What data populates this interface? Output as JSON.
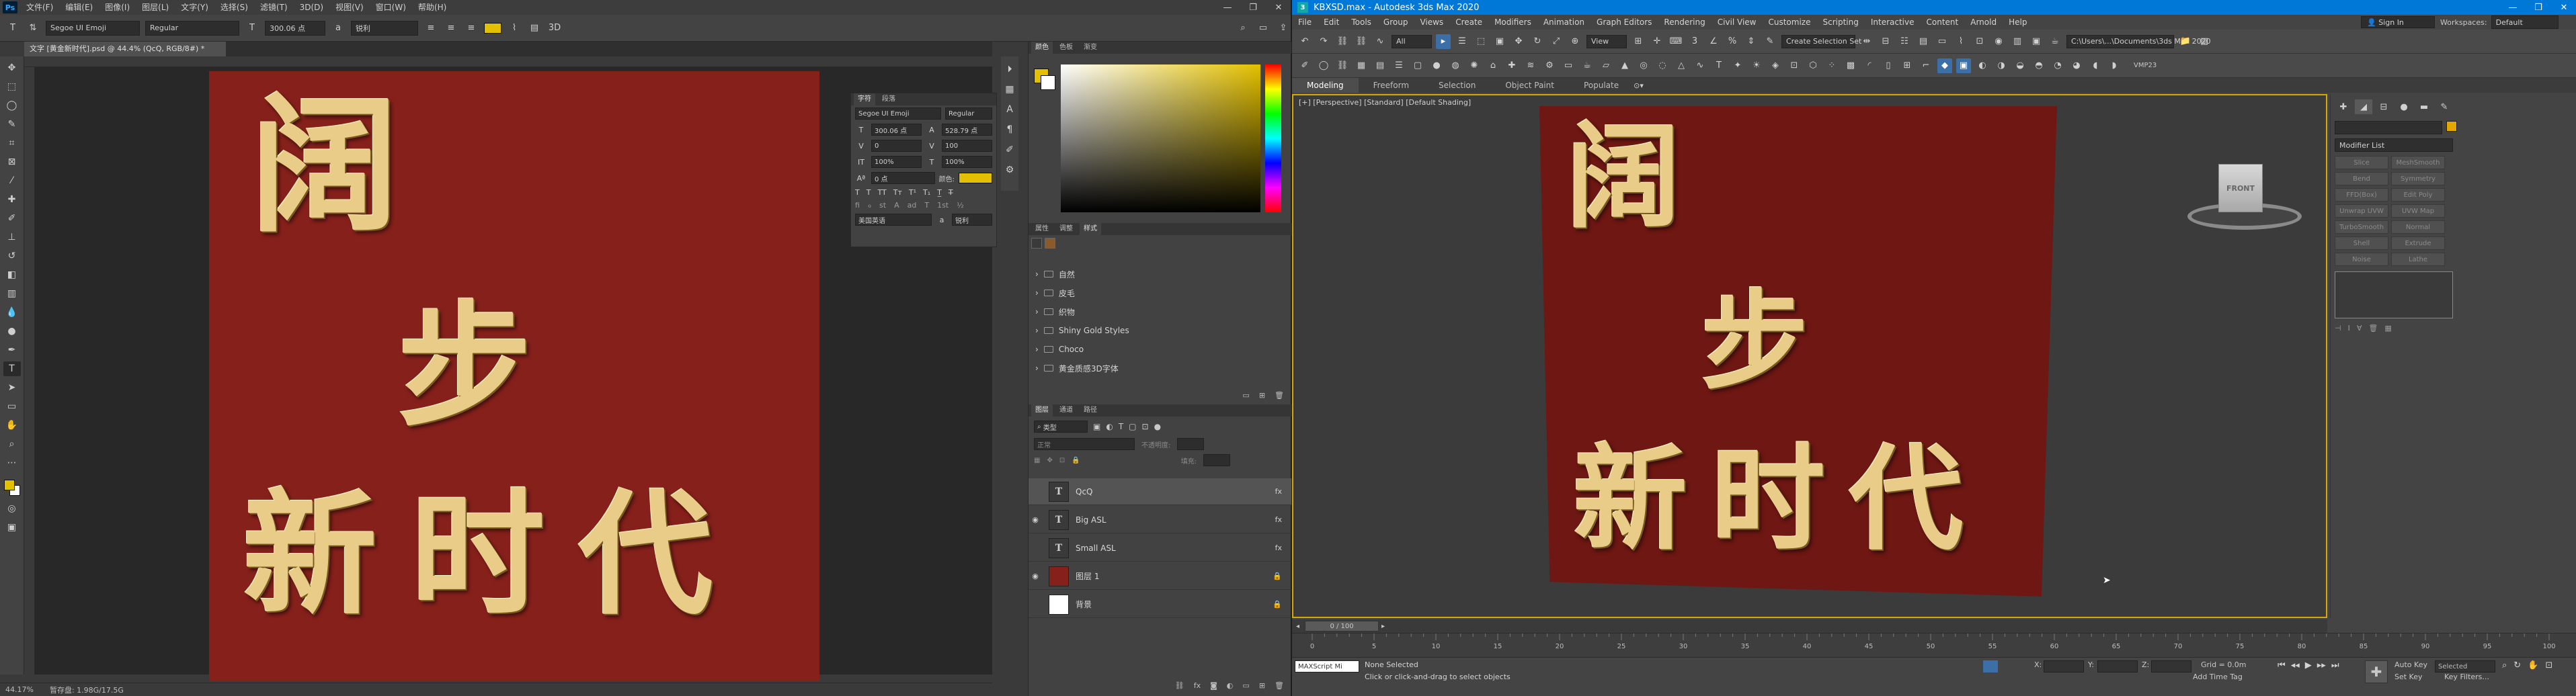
{
  "photoshop": {
    "logo": "Ps",
    "menu": [
      "文件(F)",
      "编辑(E)",
      "图像(I)",
      "图层(L)",
      "文字(Y)",
      "选择(S)",
      "滤镜(T)",
      "3D(D)",
      "视图(V)",
      "窗口(W)",
      "帮助(H)"
    ],
    "options": {
      "font_family": "Segoe UI Emoji",
      "font_style": "Regular",
      "font_size": "300.06 点",
      "antialias": "锐利",
      "text_color": "#e3c000"
    },
    "doc_tab": "文字 [黄金新时代].psd @ 44.4% (QcQ, RGB/8#) *",
    "status": {
      "zoom": "44.17%",
      "doc_size": "暂存盘: 1.98G/17.5G"
    },
    "canvas_text": {
      "row1": "阔",
      "row2": "步",
      "row3": "新 时 代"
    },
    "canvas_color": "#86201b",
    "char_panel": {
      "tabs": [
        "字符",
        "段落"
      ],
      "font_family": "Segoe UI Emoji",
      "font_style": "Regular",
      "size": "300.06 点",
      "leading": "528.79 点",
      "kerning": "0",
      "tracking": "100",
      "scale_v": "100%",
      "scale_h": "100%",
      "baseline": "0 点",
      "color_label": "颜色:",
      "language": "美国英语",
      "aa": "锐利"
    },
    "color_panel_tabs": [
      "颜色",
      "色板",
      "渐变"
    ],
    "styles_panel": {
      "tabs": [
        "属性",
        "调整",
        "样式"
      ],
      "items": [
        "自然",
        "皮毛",
        "织物",
        "Shiny Gold Styles",
        "Choco",
        "黄金质感3D字体"
      ]
    },
    "layers_panel": {
      "tabs": [
        "图层",
        "通道",
        "路径"
      ],
      "filter": "类型",
      "blend": "正常",
      "opacity_label": "不透明度:",
      "fill_label": "填充:",
      "layers": [
        {
          "name": "QcQ",
          "type": "T",
          "visible": false,
          "fx": "fx",
          "selected": true
        },
        {
          "name": "Big ASL",
          "type": "T",
          "visible": true,
          "fx": "fx",
          "selected": false
        },
        {
          "name": "Small ASL",
          "type": "T",
          "visible": false,
          "fx": "fx",
          "selected": false
        },
        {
          "name": "图层 1",
          "type": "img",
          "visible": true,
          "fx": "",
          "selected": false
        },
        {
          "name": "背景",
          "type": "bg",
          "visible": false,
          "fx": "",
          "selected": false
        }
      ]
    }
  },
  "max": {
    "logo": "3",
    "title": "KBXSD.max - Autodesk 3ds Max 2020",
    "menu": [
      "File",
      "Edit",
      "Tools",
      "Group",
      "Views",
      "Create",
      "Modifiers",
      "Animation",
      "Graph Editors",
      "Rendering",
      "Civil View",
      "Customize",
      "Scripting",
      "Interactive",
      "Content",
      "Arnold",
      "Help"
    ],
    "signin": "Sign In",
    "workspace_label": "Workspaces:",
    "workspace_value": "Default",
    "toolbar": {
      "filter": "All",
      "view": "View",
      "selection_set": "Create Selection Set",
      "path": "C:\\Users\\...\\Documents\\3ds Max 2020",
      "vmp": "VMP23"
    },
    "ribbon_tabs": [
      "Modeling",
      "Freeform",
      "Selection",
      "Object Paint",
      "Populate"
    ],
    "viewport_label": "[+] [Perspective] [Standard] [Default Shading]",
    "viewport_text": {
      "row1": "阔",
      "row2": "步",
      "row3": "新 时 代"
    },
    "plane_color": "#6e1713",
    "viewcube_label": "FRONT",
    "modifier_list": "Modifier List",
    "modifier_buttons": [
      "Slice",
      "MeshSmooth",
      "Bend",
      "Symmetry",
      "FFD(Box)",
      "Edit Poly",
      "Unwrap UVW",
      "UVW Map",
      "TurboSmooth",
      "Normal",
      "Shell",
      "Extrude",
      "Noise",
      "Lathe"
    ],
    "time_slider": "0 / 100",
    "ticks": [
      "0",
      "5",
      "10",
      "15",
      "20",
      "25",
      "30",
      "35",
      "40",
      "45",
      "50",
      "55",
      "60",
      "65",
      "70",
      "75",
      "80",
      "85",
      "90",
      "95",
      "100"
    ],
    "status": {
      "maxscript": "MAXScript Mi",
      "selection": "None Selected",
      "prompt": "Click or click-and-drag to select objects",
      "x_label": "X:",
      "y_label": "Y:",
      "z_label": "Z:",
      "grid": "Grid = 0.0m",
      "add_time_tag": "Add Time Tag",
      "auto_key": "Auto Key",
      "selected": "Selected",
      "set_key": "Set Key",
      "key_filters": "Key Filters..."
    }
  }
}
